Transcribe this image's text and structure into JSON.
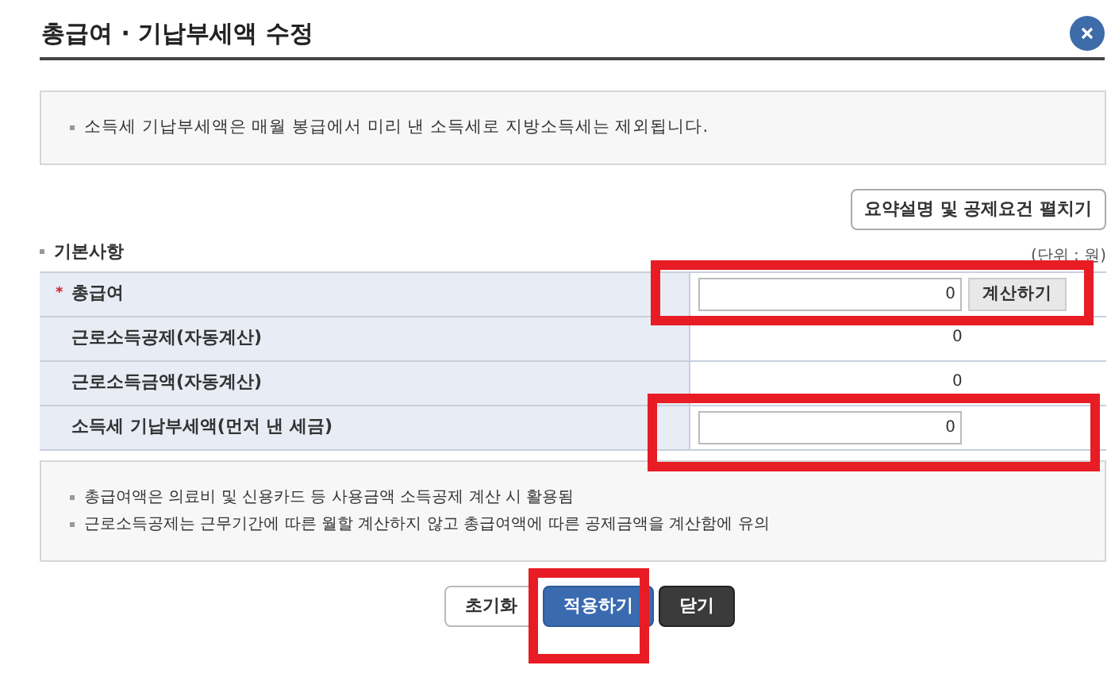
{
  "dialog": {
    "title": "총급여 · 기납부세액 수정"
  },
  "notice": "소득세 기납부세액은 매월 봉급에서 미리 낸 소득세로 지방소득세는 제외됩니다.",
  "expand_button": "요약설명 및 공제요건 펼치기",
  "section": {
    "title": "기본사항",
    "unit": "(단위 : 원)"
  },
  "rows": [
    {
      "kind": "input",
      "marker": "*",
      "label": "총급여",
      "value": "0",
      "button": "계산하기"
    },
    {
      "kind": "text",
      "label": "근로소득공제(자동계산)",
      "value": "0"
    },
    {
      "kind": "text",
      "label": "근로소득금액(자동계산)",
      "value": "0"
    },
    {
      "kind": "input",
      "label": "소득세 기납부세액(먼저 낸 세금)",
      "value": "0"
    }
  ],
  "notes": [
    "총급여액은 의료비 및 신용카드 등 사용금액 소득공제 계산 시 활용됨",
    "근로소득공제는 근무기간에 따른 월할 계산하지 않고 총급여액에 따른 공제금액을 계산함에 유의"
  ],
  "buttons": [
    {
      "kind": "reset",
      "label": "초기화"
    },
    {
      "kind": "primary",
      "label": "적용하기"
    },
    {
      "kind": "dark",
      "label": "닫기"
    }
  ]
}
